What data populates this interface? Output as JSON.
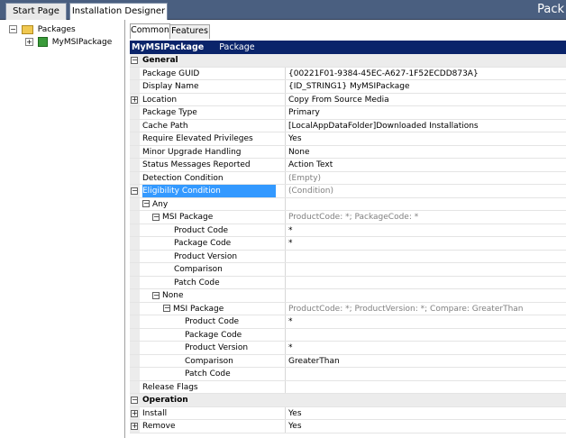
{
  "tabs": {
    "start_page": "Start Page",
    "installation_designer": "Installation Designer"
  },
  "window_title": "Pack",
  "tree": {
    "root_label": "Packages",
    "child_label": "MyMSIPackage"
  },
  "subtabs": {
    "common": "Common",
    "features": "Features"
  },
  "header": {
    "name": "MyMSIPackage",
    "kind": "Package"
  },
  "grid": {
    "general_category": "General",
    "package_guid": {
      "label": "Package GUID",
      "value": "{00221F01-9384-45EC-A627-1F52ECDD873A}"
    },
    "display_name": {
      "label": "Display Name",
      "value": "{ID_STRING1} MyMSIPackage"
    },
    "location": {
      "label": "Location",
      "value": "Copy From Source Media"
    },
    "package_type": {
      "label": "Package Type",
      "value": "Primary"
    },
    "cache_path": {
      "label": "Cache Path",
      "value": "[LocalAppDataFolder]Downloaded Installations"
    },
    "require_elevated": {
      "label": "Require Elevated Privileges",
      "value": "Yes"
    },
    "minor_upgrade": {
      "label": "Minor Upgrade Handling",
      "value": "None"
    },
    "status_messages": {
      "label": "Status Messages Reported",
      "value": "Action Text"
    },
    "detection_condition": {
      "label": "Detection Condition",
      "value": "(Empty)"
    },
    "eligibility_condition": {
      "label": "Eligibility Condition",
      "value": "(Condition)"
    },
    "any": {
      "label": "Any"
    },
    "msi_package_1": {
      "label": "MSI Package",
      "value": "ProductCode: *; PackageCode: *"
    },
    "product_code_1": {
      "label": "Product Code",
      "value": "*"
    },
    "package_code_1": {
      "label": "Package Code",
      "value": "*"
    },
    "product_version_1": {
      "label": "Product Version",
      "value": ""
    },
    "comparison_1": {
      "label": "Comparison",
      "value": ""
    },
    "patch_code_1": {
      "label": "Patch Code",
      "value": ""
    },
    "none": {
      "label": "None"
    },
    "msi_package_2": {
      "label": "MSI Package",
      "value": "ProductCode: *; ProductVersion: *; Compare: GreaterThan"
    },
    "product_code_2": {
      "label": "Product Code",
      "value": "*"
    },
    "package_code_2": {
      "label": "Package Code",
      "value": ""
    },
    "product_version_2": {
      "label": "Product Version",
      "value": "*"
    },
    "comparison_2": {
      "label": "Comparison",
      "value": "GreaterThan"
    },
    "patch_code_2": {
      "label": "Patch Code",
      "value": ""
    },
    "release_flags": {
      "label": "Release Flags",
      "value": ""
    },
    "operation_category": "Operation",
    "install": {
      "label": "Install",
      "value": "Yes"
    },
    "remove": {
      "label": "Remove",
      "value": "Yes"
    }
  },
  "colors": {
    "title_bar": "#4a5f80",
    "header_bar": "#0a246a",
    "selection": "#3399ff"
  }
}
